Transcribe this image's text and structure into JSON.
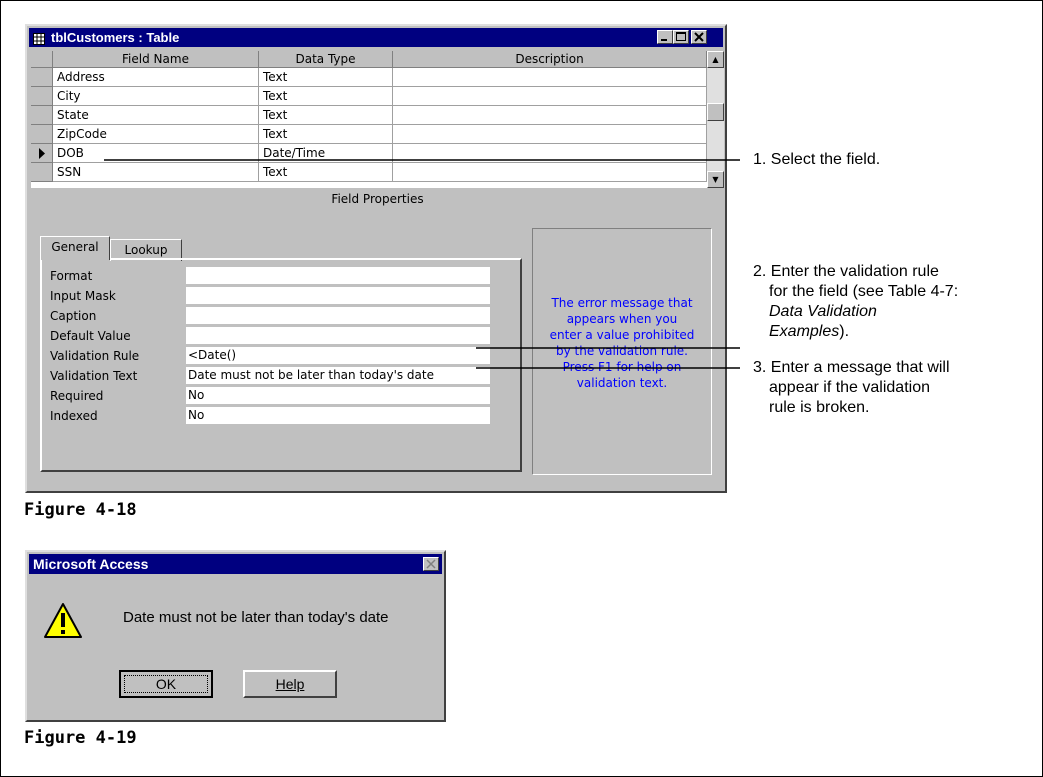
{
  "table_window": {
    "title": "tblCustomers : Table",
    "columns": [
      "Field Name",
      "Data Type",
      "Description"
    ],
    "rows": [
      {
        "field": "Address",
        "type": "Text",
        "desc": ""
      },
      {
        "field": "City",
        "type": "Text",
        "desc": ""
      },
      {
        "field": "State",
        "type": "Text",
        "desc": ""
      },
      {
        "field": "ZipCode",
        "type": "Text",
        "desc": ""
      },
      {
        "field": "DOB",
        "type": "Date/Time",
        "desc": ""
      },
      {
        "field": "SSN",
        "type": "Text",
        "desc": ""
      }
    ],
    "field_properties_label": "Field Properties",
    "tabs": [
      "General",
      "Lookup"
    ],
    "properties": [
      {
        "label": "Format",
        "value": ""
      },
      {
        "label": "Input Mask",
        "value": ""
      },
      {
        "label": "Caption",
        "value": ""
      },
      {
        "label": "Default Value",
        "value": ""
      },
      {
        "label": "Validation Rule",
        "value": "<Date()"
      },
      {
        "label": "Validation Text",
        "value": "Date must not be later than today's date"
      },
      {
        "label": "Required",
        "value": "No"
      },
      {
        "label": "Indexed",
        "value": "No"
      }
    ],
    "help_text": [
      "The error message that",
      "appears when you",
      "enter a value prohibited",
      "by the validation rule.",
      "Press F1 for help on",
      "validation text."
    ]
  },
  "callouts": {
    "c1": "1. Select the field.",
    "c2_line1": "2. Enter the validation rule",
    "c2_line2": "for the field (see Table 4-7:",
    "c2_line3_italic": "Data Validation",
    "c2_line4_italic": "Examples",
    "c2_line4_tail": ").",
    "c3_line1": "3. Enter a message that will",
    "c3_line2": "appear if the validation",
    "c3_line3": "rule is broken."
  },
  "figures": {
    "fig1": "Figure 4-18",
    "fig2": "Figure 4-19"
  },
  "dialog": {
    "title": "Microsoft Access",
    "message": "Date must not be later than today's date",
    "ok_label": "OK",
    "help_label": "Help"
  }
}
